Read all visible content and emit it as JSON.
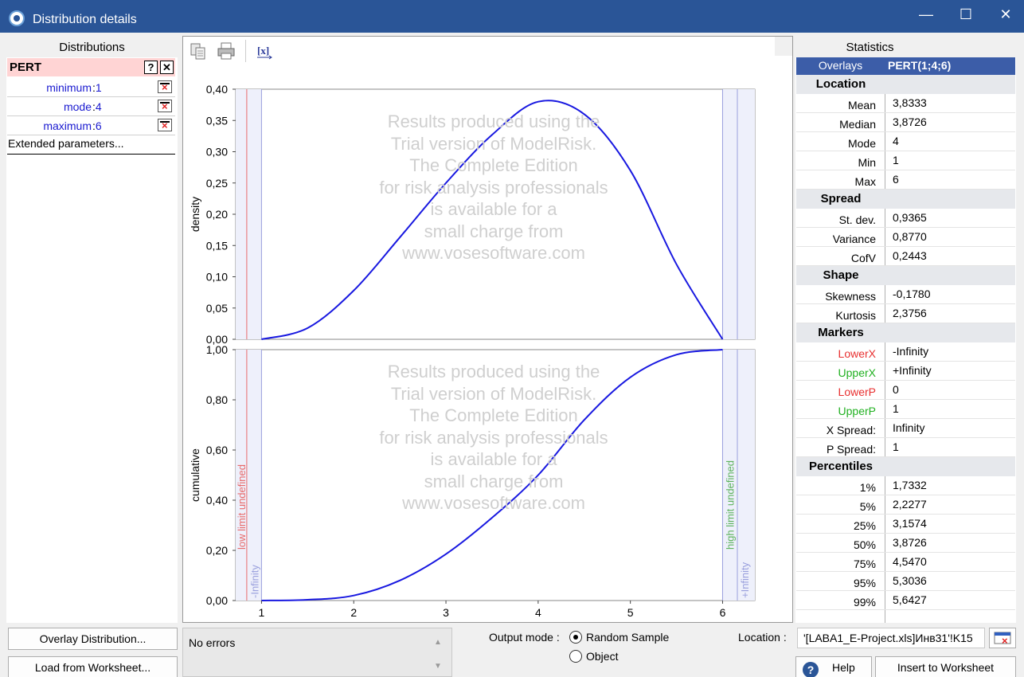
{
  "window": {
    "title": "Distribution details",
    "min": "—",
    "max": "☐",
    "close": "✕"
  },
  "distributions": {
    "heading": "Distributions",
    "name": "PERT",
    "help": "?",
    "remove": "✕",
    "params": [
      {
        "label": "minimum",
        "value": "1"
      },
      {
        "label": "mode",
        "value": "4"
      },
      {
        "label": "maximum",
        "value": "6"
      }
    ],
    "extended": "Extended parameters..."
  },
  "watermark": [
    "Results produced using the",
    "Trial version of ModelRisk.",
    "The Complete Edition",
    "for risk analysis professionals",
    "is available for a",
    "small charge from",
    "www.vosesoftware.com"
  ],
  "chart_data": [
    {
      "type": "line",
      "ylabel": "density",
      "xlim": [
        0.72,
        6.35
      ],
      "ylim": [
        0,
        0.4
      ],
      "yticks": [
        "0,00",
        "0,05",
        "0,10",
        "0,15",
        "0,20",
        "0,25",
        "0,30",
        "0,35",
        "0,40"
      ],
      "x": [
        1.0,
        1.5,
        2.0,
        2.5,
        3.0,
        3.5,
        4.0,
        4.5,
        5.0,
        5.5,
        6.0
      ],
      "y": [
        0.0,
        0.018,
        0.078,
        0.163,
        0.25,
        0.327,
        0.38,
        0.36,
        0.27,
        0.12,
        0.0
      ],
      "color": "#1818e0"
    },
    {
      "type": "line",
      "ylabel": "cumulative",
      "xlim": [
        0.72,
        6.35
      ],
      "ylim": [
        0,
        1.0
      ],
      "yticks": [
        "0,00",
        "0,20",
        "0,40",
        "0,60",
        "0,80",
        "1,00"
      ],
      "xticks": [
        "1",
        "2",
        "3",
        "4",
        "5",
        "6"
      ],
      "x": [
        1.0,
        1.5,
        2.0,
        2.5,
        3.0,
        3.5,
        4.0,
        4.5,
        5.0,
        5.5,
        6.0
      ],
      "y": [
        0.0,
        0.003,
        0.02,
        0.08,
        0.185,
        0.33,
        0.5,
        0.72,
        0.89,
        0.98,
        1.0
      ],
      "color": "#1818e0",
      "annotations": {
        "low_limit": "low limit undefined",
        "minus_infinity": "-Infinity",
        "high_limit": "high limit undefined",
        "plus_infinity": "+Infinity"
      }
    }
  ],
  "statistics": {
    "heading": "Statistics",
    "overlays_label": "Overlays",
    "overlays_value": "PERT(1;4;6)",
    "sections": [
      {
        "title": "Location",
        "rows": [
          {
            "label": "Mean",
            "value": "3,8333"
          },
          {
            "label": "Median",
            "value": "3,8726"
          },
          {
            "label": "Mode",
            "value": "4"
          },
          {
            "label": "Min",
            "value": "1"
          },
          {
            "label": "Max",
            "value": "6"
          }
        ]
      },
      {
        "title": "Spread",
        "rows": [
          {
            "label": "St. dev.",
            "value": "0,9365"
          },
          {
            "label": "Variance",
            "value": "0,8770"
          },
          {
            "label": "CofV",
            "value": "0,2443"
          }
        ]
      },
      {
        "title": "Shape",
        "rows": [
          {
            "label": "Skewness",
            "value": "-0,1780"
          },
          {
            "label": "Kurtosis",
            "value": "2,3756"
          }
        ]
      },
      {
        "title": "Markers",
        "rows": [
          {
            "label": "LowerX",
            "value": "-Infinity",
            "color": "#e83030"
          },
          {
            "label": "UpperX",
            "value": "+Infinity",
            "color": "#20b020"
          },
          {
            "label": "LowerP",
            "value": "0",
            "color": "#e83030"
          },
          {
            "label": "UpperP",
            "value": "1",
            "color": "#20b020"
          },
          {
            "label": "X Spread:",
            "value": "Infinity"
          },
          {
            "label": "P Spread:",
            "value": "1"
          }
        ]
      },
      {
        "title": "Percentiles",
        "rows": [
          {
            "label": "1%",
            "value": "1,7332"
          },
          {
            "label": "5%",
            "value": "2,2277"
          },
          {
            "label": "25%",
            "value": "3,1574"
          },
          {
            "label": "50%",
            "value": "3,8726"
          },
          {
            "label": "75%",
            "value": "4,5470"
          },
          {
            "label": "95%",
            "value": "5,3036"
          },
          {
            "label": "99%",
            "value": "5,6427"
          }
        ]
      }
    ]
  },
  "bottom": {
    "overlay_btn": "Overlay Distribution...",
    "load_btn": "Load from Worksheet...",
    "status": "No errors",
    "output_mode_label": "Output mode :",
    "random_sample": "Random Sample",
    "object": "Object",
    "location_label": "Location :",
    "location_value": "'[LABA1_E-Project.xls]Инв31'!K15",
    "help_btn": "Help",
    "insert_btn": "Insert to Worksheet"
  }
}
